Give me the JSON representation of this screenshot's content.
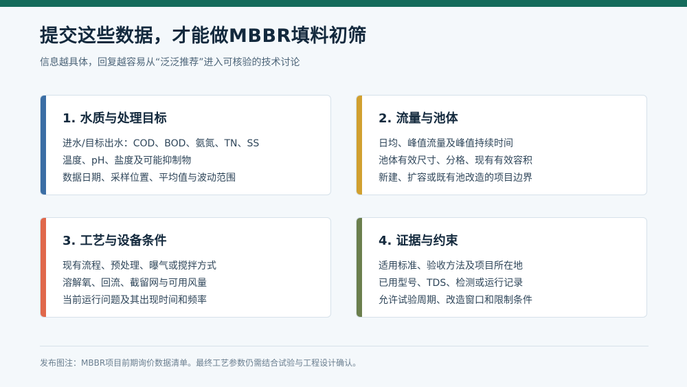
{
  "page": {
    "title": "提交这些数据，才能做MBBR填料初筛",
    "subtitle": "信息越具体，回复越容易从“泛泛推荐”进入可核验的技术讨论",
    "footnote": "发布图注：MBBR项目前期询价数据清单。最终工艺参数仍需结合试验与工程设计确认。"
  },
  "colors": {
    "top_bar": "#146b5b",
    "accent_blue": "#3b6ea5",
    "accent_gold": "#d1a02f",
    "accent_orange": "#e0684b",
    "accent_green": "#6b7f4d"
  },
  "cards": [
    {
      "title": "1. 水质与处理目标",
      "items": [
        "进水/目标出水：COD、BOD、氨氮、TN、SS",
        "温度、pH、盐度及可能抑制物",
        "数据日期、采样位置、平均值与波动范围"
      ]
    },
    {
      "title": "2. 流量与池体",
      "items": [
        "日均、峰值流量及峰值持续时间",
        "池体有效尺寸、分格、现有有效容积",
        "新建、扩容或既有池改造的项目边界"
      ]
    },
    {
      "title": "3. 工艺与设备条件",
      "items": [
        "现有流程、预处理、曝气或搅拌方式",
        "溶解氧、回流、截留网与可用风量",
        "当前运行问题及其出现时间和频率"
      ]
    },
    {
      "title": "4. 证据与约束",
      "items": [
        "适用标准、验收方法及项目所在地",
        "已用型号、TDS、检测或运行记录",
        "允许试验周期、改造窗口和限制条件"
      ]
    }
  ]
}
